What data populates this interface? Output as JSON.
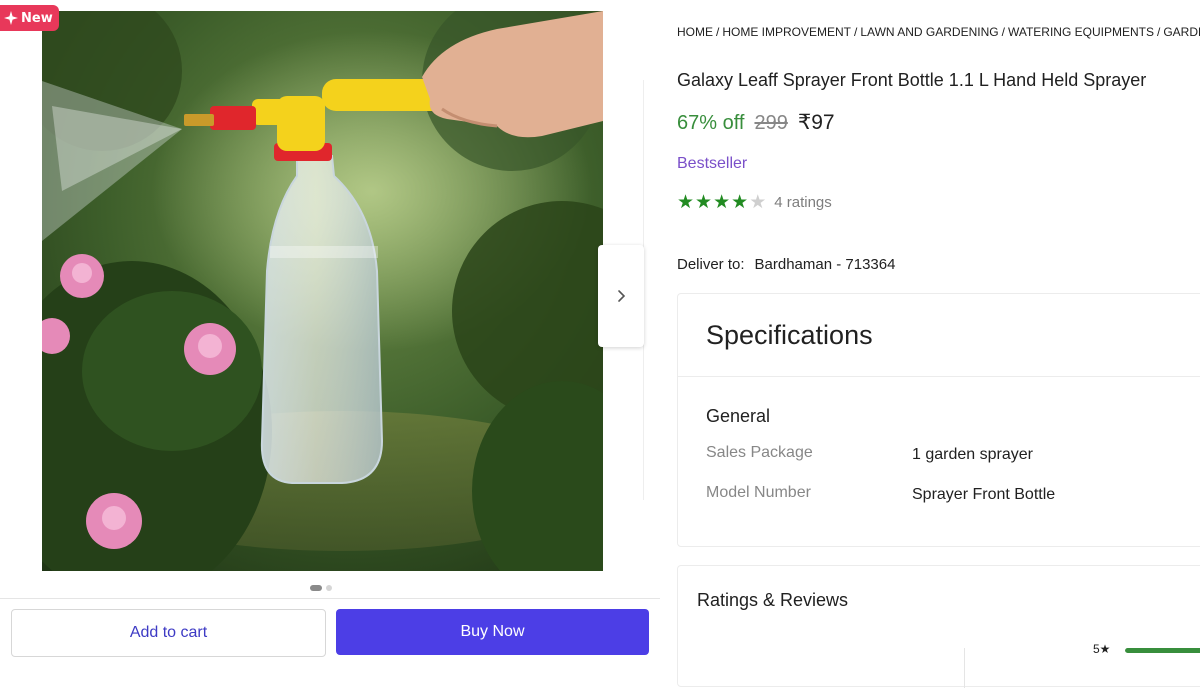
{
  "badge": {
    "label": "New",
    "icon": "sparkle-icon"
  },
  "gallery": {
    "image_alt": "Galaxy Leaff Sprayer Front Bottle 1.1 L Hand Held Sprayer",
    "dot_count": 2,
    "active_dot": 1,
    "next_icon": "chevron-right-icon"
  },
  "actions": {
    "add_to_cart": "Add to cart",
    "buy_now": "Buy Now"
  },
  "breadcrumb": [
    "HOME",
    "HOME IMPROVEMENT",
    "LAWN AND GARDENING",
    "WATERING EQUIPMENTS",
    "GARDEN S"
  ],
  "product": {
    "title": "Galaxy Leaff Sprayer Front Bottle 1.1 L Hand Held Sprayer",
    "discount": "67% off",
    "mrp": "299",
    "price": "₹97",
    "tag": "Bestseller",
    "rating": 4,
    "rating_max": 5,
    "ratings_text": "4 ratings"
  },
  "delivery": {
    "label": "Deliver to:",
    "location": "Bardhaman - 713364"
  },
  "specifications": {
    "title": "Specifications",
    "group": "General",
    "rows": [
      {
        "key": "Sales Package",
        "value": "1 garden sprayer"
      },
      {
        "key": "Model Number",
        "value": "Sprayer Front Bottle"
      }
    ]
  },
  "reviews": {
    "title": "Ratings & Reviews",
    "bars": [
      {
        "label": "5★",
        "fraction": 1.0
      }
    ]
  },
  "colors": {
    "accent": "#4c3ee6",
    "discount_green": "#388e3c",
    "star_green": "#228b22",
    "bestseller_purple": "#7a4fc9",
    "badge_pink": "#e8385a"
  }
}
